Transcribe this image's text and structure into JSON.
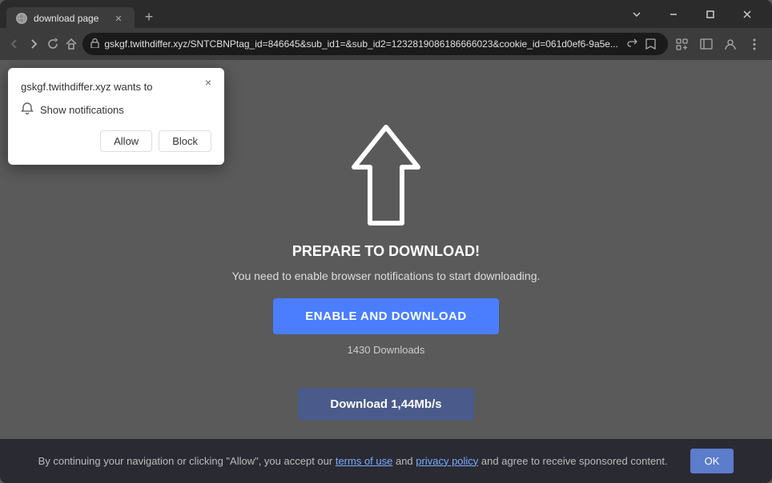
{
  "browser": {
    "tab": {
      "title": "download page",
      "favicon": "globe"
    },
    "new_tab_label": "+",
    "window_controls": {
      "minimize": "—",
      "maximize": "□",
      "close": "✕"
    },
    "nav": {
      "back": "←",
      "forward": "→",
      "refresh": "↻",
      "home": "⌂"
    },
    "address": "gskgf.twithdiffer.xyz/SNTCBNPtag_id=846645&sub_id1=&sub_id2=1232819086186666023&cookie_id=061d0ef6-9a5e...",
    "toolbar": {
      "share": "⎙",
      "bookmark": "☆",
      "extensions": "⬜",
      "sidebar": "▣",
      "profile": "👤",
      "menu": "⋮"
    }
  },
  "popup": {
    "title": "gskgf.twithdiffer.xyz wants to",
    "close": "×",
    "notification_label": "Show notifications",
    "allow_label": "Allow",
    "block_label": "Block"
  },
  "main": {
    "heading": "PREPARE TO DOWNLOAD!",
    "subtext": "You need to enable browser notifications to start downloading.",
    "enable_btn": "ENABLE AND DOWNLOAD",
    "downloads_count": "1430 Downloads",
    "download_bar_prefix": "Download ",
    "download_bar_speed": "1,44Mb/s"
  },
  "banner": {
    "text_before": "By continuing your navigation or clicking \"Allow\", you accept our ",
    "terms_link": "terms of use",
    "text_mid": " and ",
    "privacy_link": "privacy policy",
    "text_after": " and agree to receive sponsored content.",
    "ok_label": "OK"
  }
}
